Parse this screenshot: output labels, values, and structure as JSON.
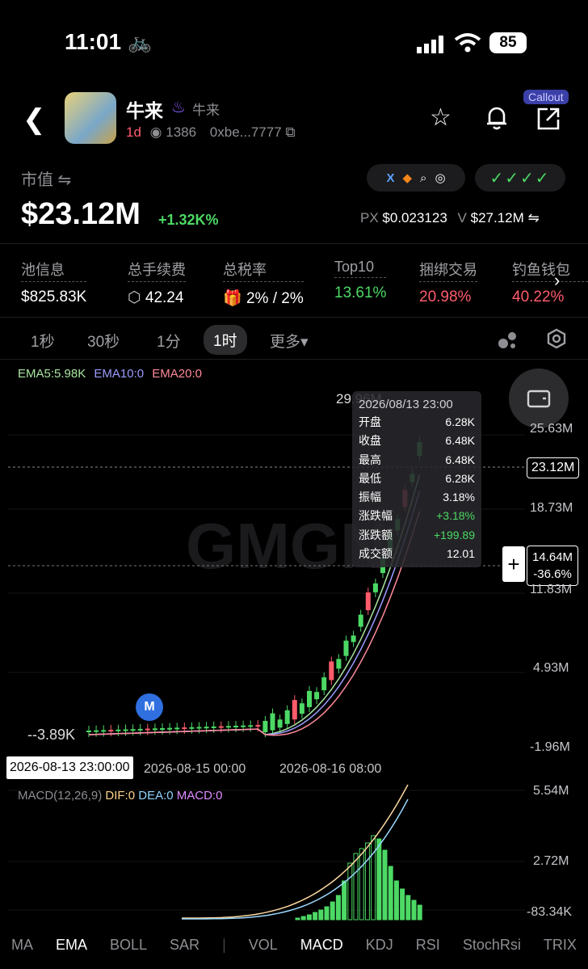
{
  "status_bar": {
    "time": "11:01",
    "battery": "85"
  },
  "token": {
    "name": "牛来",
    "subname": "牛来",
    "age": "1d",
    "views": "1386",
    "address": "0xbe...7777"
  },
  "header": {
    "callout_label": "Callout"
  },
  "market": {
    "mcap_label": "市值 ⇋",
    "mcap": "$23.12M",
    "mcap_change": "+1.32K%",
    "px_label": "PX",
    "px": "$0.023123",
    "vol_label": "V",
    "vol": "$27.12M ⇋",
    "audit_checks": "✓✓✓✓"
  },
  "stats": [
    {
      "label": "池信息",
      "value": "$825.83K"
    },
    {
      "label": "总手续费",
      "value": "42.24"
    },
    {
      "label": "总税率",
      "value": "2% / 2%"
    },
    {
      "label": "Top10",
      "value": "13.61%"
    },
    {
      "label": "捆绑交易",
      "value": "20.98%"
    },
    {
      "label": "钓鱼钱包",
      "value": "40.22%"
    }
  ],
  "timeframes": [
    "1秒",
    "30秒",
    "1分",
    "1时",
    "更多▾"
  ],
  "chart": {
    "ema_legend": {
      "ema5": "EMA5:5.98K",
      "ema10": "EMA10:0",
      "ema20": "EMA20:0"
    },
    "y_labels": [
      "25.63M",
      "18.73M",
      "11.83M",
      "4.93M",
      "-1.96M"
    ],
    "current_price": "23.12M",
    "high_label": "29.96M",
    "low_label": "3.89K",
    "crosshair_value": "14.64M",
    "crosshair_pct": "-36.6%",
    "x_labels": [
      "2026-08-15 00:00",
      "2026-08-16 08:00"
    ],
    "selected_date": "2026-08-13 23:00:00",
    "watermark": "GMGN",
    "marker": "M"
  },
  "tooltip": {
    "title": "2026/08/13 23:00",
    "rows": [
      {
        "k": "开盘",
        "v": "6.28K"
      },
      {
        "k": "收盘",
        "v": "6.48K"
      },
      {
        "k": "最高",
        "v": "6.48K"
      },
      {
        "k": "最低",
        "v": "6.28K"
      },
      {
        "k": "振幅",
        "v": "3.18%"
      },
      {
        "k": "涨跌幅",
        "v": "+3.18%"
      },
      {
        "k": "涨跌额",
        "v": "+199.89"
      },
      {
        "k": "成交额",
        "v": "12.01"
      }
    ]
  },
  "macd": {
    "legend": "MACD(12,26,9)",
    "dif": "DIF:0",
    "dea": "DEA:0",
    "macd": "MACD:0",
    "y_labels": [
      "5.54M",
      "2.72M",
      "-83.34K"
    ]
  },
  "bottom_tabs": [
    "MA",
    "EMA",
    "BOLL",
    "SAR",
    "|",
    "VOL",
    "MACD",
    "KDJ",
    "RSI",
    "StochRsi",
    "TRIX"
  ],
  "colors": {
    "up": "#4cd964",
    "down": "#ff5c6c",
    "ema5": "#a8e6a0",
    "ema10": "#9b9bff",
    "ema20": "#ff8a9a"
  }
}
